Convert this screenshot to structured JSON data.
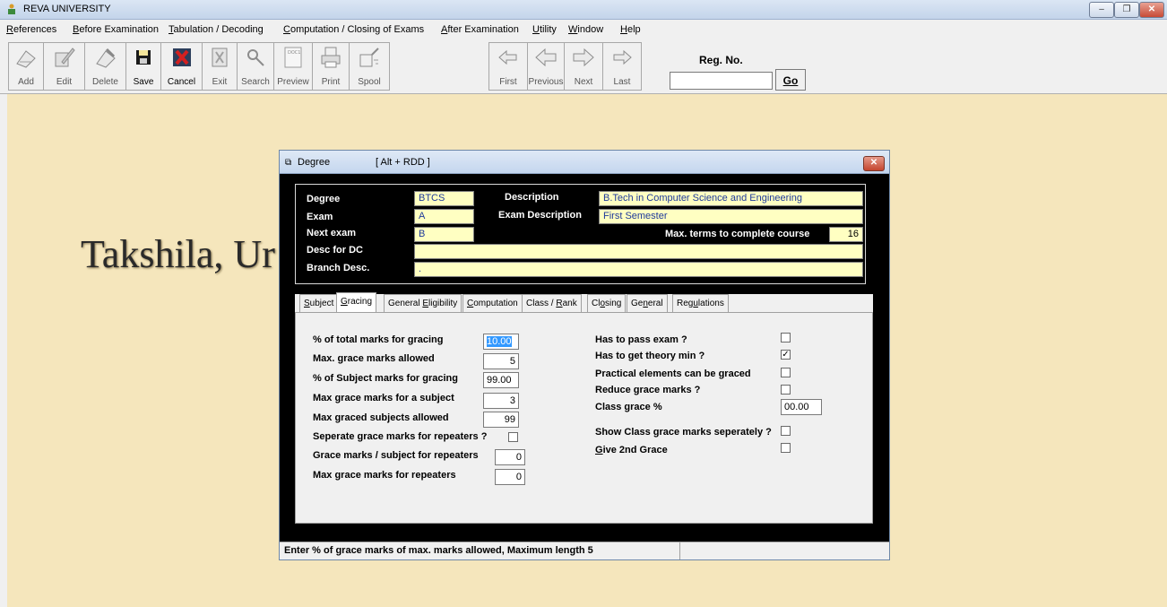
{
  "window": {
    "title": "REVA UNIVERSITY",
    "controls": {
      "minimize": "–",
      "restore": "❐",
      "close": "✕"
    }
  },
  "menu": [
    {
      "label": "References",
      "u": "R"
    },
    {
      "label": "Before Examination",
      "u": "B"
    },
    {
      "label": "Tabulation / Decoding",
      "u": "T"
    },
    {
      "label": "Computation / Closing of Exams",
      "u": "C"
    },
    {
      "label": "After Examination",
      "u": "A"
    },
    {
      "label": "Utility",
      "u": "U"
    },
    {
      "label": "Window",
      "u": "W"
    },
    {
      "label": "Help",
      "u": "H"
    }
  ],
  "toolbar": {
    "add": "Add",
    "edit": "Edit",
    "delete": "Delete",
    "save": "Save",
    "cancel": "Cancel",
    "exit": "Exit",
    "search": "Search",
    "preview": "Preview",
    "print": "Print",
    "spool": "Spool",
    "first": "First",
    "previous": "Previous",
    "next": "Next",
    "last": "Last",
    "regno_label": "Reg. No.",
    "regno_value": "",
    "go": "Go"
  },
  "background_text": "Takshila, Ur",
  "dialog": {
    "title": "Degree",
    "shortcut": "[ Alt + RDD ]",
    "close": "✕",
    "header": {
      "degree_label": "Degree",
      "degree_value": "BTCS",
      "description_label": "Description",
      "description_value": "B.Tech in Computer Science and Engineering",
      "exam_label": "Exam",
      "exam_value": "A",
      "exam_desc_label": "Exam Description",
      "exam_desc_value": "First Semester",
      "next_exam_label": "Next exam",
      "next_exam_value": "B",
      "max_terms_label": "Max. terms to complete course",
      "max_terms_value": "16",
      "desc_dc_label": "Desc for DC",
      "desc_dc_value": "",
      "branch_label": "Branch Desc.",
      "branch_value": "."
    },
    "tabs": [
      {
        "label": "Subject",
        "u": "S"
      },
      {
        "label": "Gracing",
        "u": "G"
      },
      {
        "label": "General Eligibility",
        "u": "E"
      },
      {
        "label": "Computation",
        "u": "C"
      },
      {
        "label": "Class / Rank",
        "u": "R"
      },
      {
        "label": "Closing",
        "u": "o"
      },
      {
        "label": "General",
        "u": "n"
      },
      {
        "label": "Regulations",
        "u": "u"
      }
    ],
    "selected_tab": "Gracing",
    "gracing": {
      "pct_total_label": "% of total marks for gracing",
      "pct_total_value": "10.00",
      "max_grace_label": "Max. grace marks allowed",
      "max_grace_value": "5",
      "pct_subject_label": "% of  Subject marks for gracing",
      "pct_subject_value": "99.00",
      "max_subject_label": "Max grace marks for a subject",
      "max_subject_value": "3",
      "max_subjects_label": "Max graced subjects allowed",
      "max_subjects_value": "99",
      "separate_label": "Seperate grace marks for repeaters ?",
      "separate_checked": false,
      "per_subject_rep_label": "Grace marks / subject for repeaters",
      "per_subject_rep_value": "0",
      "max_rep_label": "Max grace marks for repeaters",
      "max_rep_value": "0",
      "pass_exam_label": "Has to pass exam ?",
      "pass_exam_checked": false,
      "theory_min_label": "Has to get theory min ?",
      "theory_min_checked": true,
      "practical_label": "Practical elements can be graced",
      "practical_checked": false,
      "reduce_label": "Reduce grace marks ?",
      "reduce_checked": false,
      "class_grace_label": "Class grace %",
      "class_grace_value": "00.00",
      "show_class_label": "Show Class grace marks seperately ?",
      "show_class_checked": false,
      "second_grace_label": "Give 2nd Grace",
      "second_grace_checked": false
    },
    "status": "Enter % of grace marks of max. marks allowed, Maximum length 5",
    "status_right": ""
  }
}
